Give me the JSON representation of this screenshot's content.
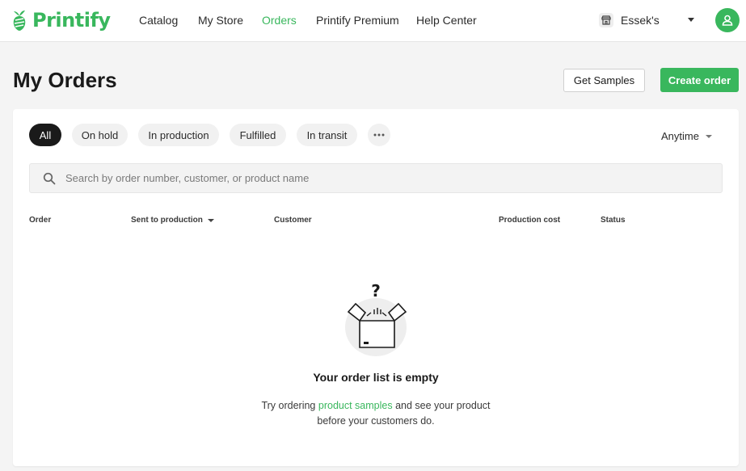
{
  "brand": {
    "name": "Printify",
    "color": "#39b75d"
  },
  "nav": {
    "items": [
      {
        "label": "Catalog",
        "active": false
      },
      {
        "label": "My Store",
        "active": false
      },
      {
        "label": "Orders",
        "active": true
      },
      {
        "label": "Printify Premium",
        "active": false
      },
      {
        "label": "Help Center",
        "active": false
      }
    ],
    "store_name": "Essek's",
    "store_icon": "storefront-icon",
    "avatar_icon": "user-icon"
  },
  "page": {
    "title": "My Orders",
    "get_samples_label": "Get Samples",
    "create_order_label": "Create order"
  },
  "filters": {
    "chips": [
      {
        "label": "All",
        "active": true
      },
      {
        "label": "On hold",
        "active": false
      },
      {
        "label": "In production",
        "active": false
      },
      {
        "label": "Fulfilled",
        "active": false
      },
      {
        "label": "In transit",
        "active": false
      }
    ],
    "more_icon": "more-horizontal-icon",
    "date_filter": "Anytime"
  },
  "search": {
    "placeholder": "Search by order number, customer, or product name"
  },
  "table": {
    "columns": [
      "Order",
      "Sent to production",
      "Customer",
      "Production cost",
      "Status"
    ]
  },
  "empty_state": {
    "icon": "empty-box-question-icon",
    "title": "Your order list is empty",
    "desc_before": "Try ordering ",
    "desc_link": "product samples",
    "desc_after": " and see your product",
    "desc_line2": "before your customers do."
  }
}
